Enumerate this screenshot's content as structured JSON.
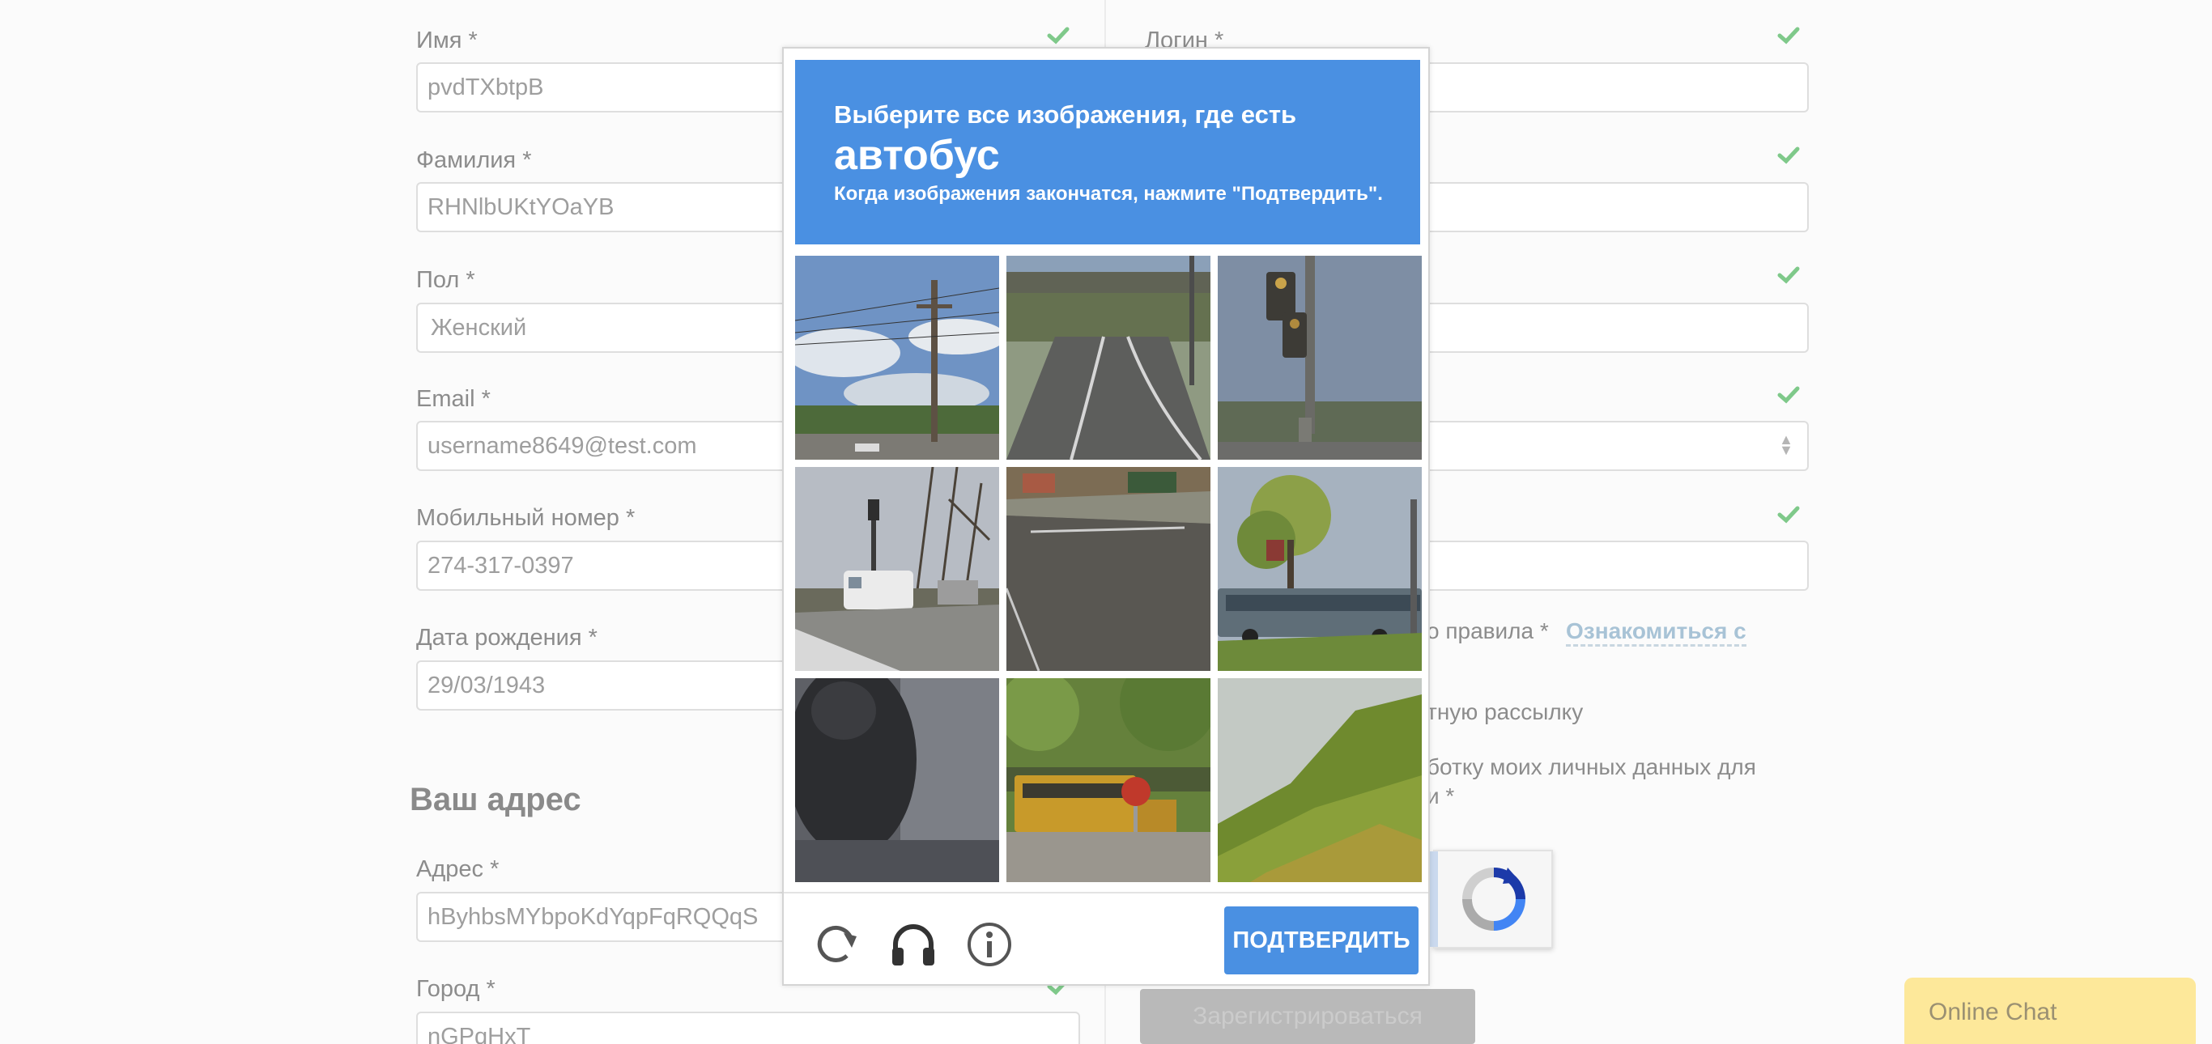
{
  "form": {
    "left": [
      {
        "label": "Имя *",
        "value": "pvdTXbtpB"
      },
      {
        "label": "Фамилия *",
        "value": "RHNlbUKtYOaYB"
      },
      {
        "label": "Пол *",
        "value": "Женский"
      },
      {
        "label": "Email *",
        "value": "username8649@test.com"
      },
      {
        "label": "Мобильный номер *",
        "value": "274-317-0397"
      },
      {
        "label": "Дата рождения *",
        "value": "29/03/1943"
      }
    ],
    "address_section_title": "Ваш адрес",
    "address": {
      "label": "Адрес *",
      "value": "hByhbsMYbpoKdYqpFqRQQqS"
    },
    "city": {
      "label": "Город *",
      "value": "nGPqHxT"
    },
    "right": {
      "login_label": "Логин *",
      "rules_text": "о правила *",
      "rules_link": "Ознакомиться с",
      "newsletter_text": "тную рассылку",
      "consent_line1": "ботку моих личных данных для",
      "consent_line2": "и *"
    },
    "submit_label": "Зарегистрироваться"
  },
  "captcha": {
    "instruction": "Выберите все изображения, где есть",
    "target": "автобус",
    "hint": "Когда изображения закончатся, нажмите \"Подтвердить\".",
    "tiles": [
      "utility-pole-sky",
      "road-overpass",
      "traffic-light",
      "street-with-van",
      "road-curb",
      "street-with-bus",
      "dark-blur",
      "school-bus-stop-sign",
      "grassy-hill"
    ],
    "verify_label": "ПОДТВЕРДИТЬ"
  },
  "chat": {
    "label": "Online Chat"
  },
  "colors": {
    "accent": "#4a90e2",
    "check": "#7fc98a",
    "chat_bg": "#fde89a"
  }
}
